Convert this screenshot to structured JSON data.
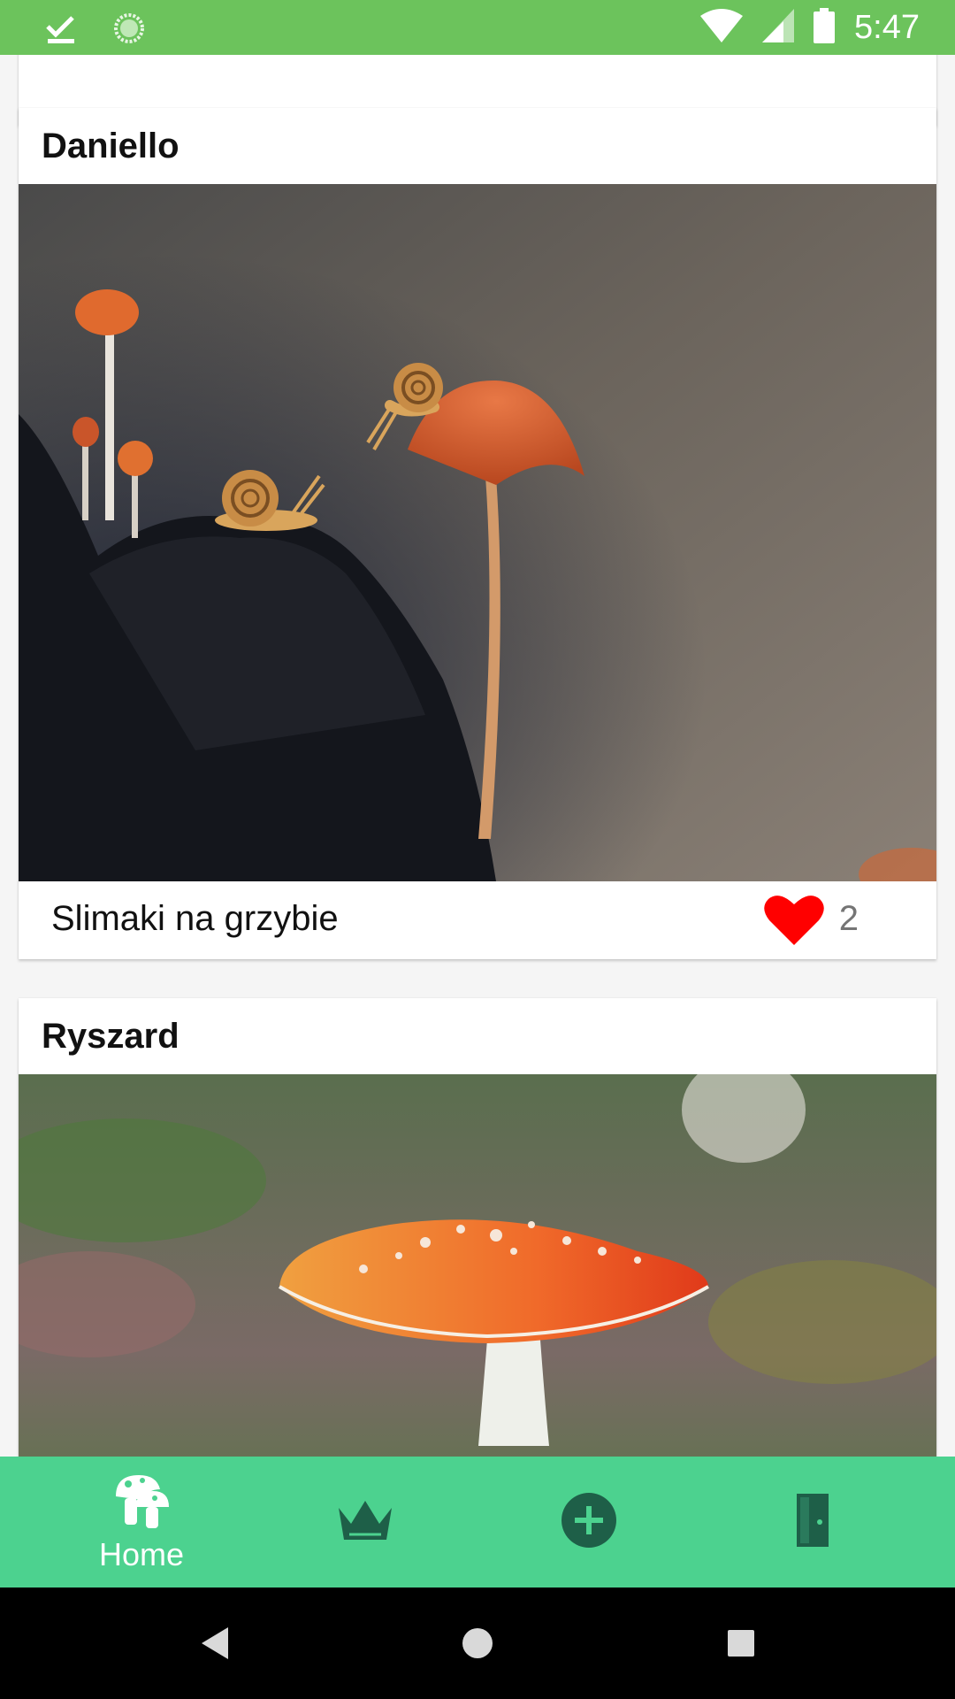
{
  "status_bar": {
    "time": "5:47",
    "icons": [
      "download-done-icon",
      "sync-icon",
      "wifi-icon",
      "signal-icon",
      "battery-icon"
    ],
    "background": "#6cc35c"
  },
  "feed": {
    "posts": [
      {
        "author": "Daniello",
        "caption": "Slimaki na grzybie",
        "likes": "2",
        "liked": true,
        "photo": "snails-on-mushroom-photo"
      },
      {
        "author": "Ryszard",
        "photo": "fly-agaric-mushroom-photo"
      }
    ]
  },
  "bottom_nav": {
    "background": "#4cd28f",
    "items": [
      {
        "label": "Home",
        "icon": "mushroom-icon",
        "active": true
      },
      {
        "icon": "crown-icon"
      },
      {
        "icon": "add-circle-icon"
      },
      {
        "icon": "door-icon"
      }
    ]
  },
  "system_nav": {
    "buttons": [
      "back-icon",
      "home-circle-icon",
      "recents-square-icon"
    ]
  },
  "colors": {
    "like_red": "#ff0000",
    "nav_icon_dark": "#1e5f48"
  }
}
